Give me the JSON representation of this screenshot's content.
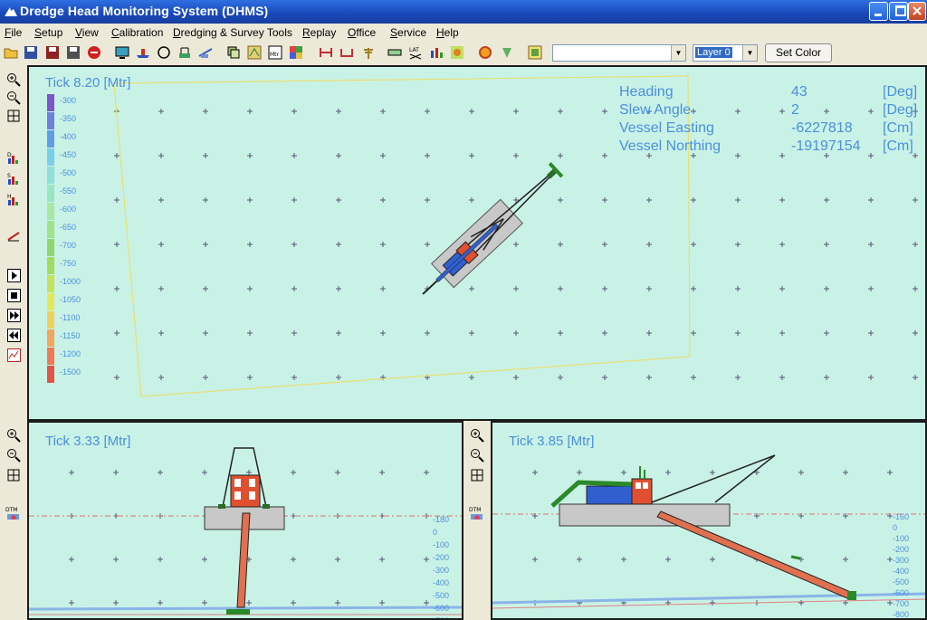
{
  "window": {
    "title": "Dredge Head Monitoring System (DHMS)"
  },
  "menu": [
    "File",
    "Setup",
    "View",
    "Calibration",
    "Dredging & Survey Tools",
    "Replay",
    "Office",
    "Service",
    "Help"
  ],
  "toolbar": {
    "combo_value": "",
    "layer_value": "Layer 0",
    "set_color_label": "Set Color"
  },
  "plan_view": {
    "tick_label": "Tick 8.20 [Mtr]",
    "info": [
      {
        "label": "Heading",
        "value": "43",
        "unit": "[Deg]"
      },
      {
        "label": "Slew Angle",
        "value": "2",
        "unit": "[Deg]"
      },
      {
        "label": "Vessel Easting",
        "value": "-6227818",
        "unit": "[Cm]"
      },
      {
        "label": "Vessel Northing",
        "value": "-19197154",
        "unit": "[Cm]"
      }
    ],
    "legend": [
      {
        "label": "-300",
        "color": "#7a55cc"
      },
      {
        "label": "-350",
        "color": "#6f7fdc"
      },
      {
        "label": "-400",
        "color": "#5f9ee6"
      },
      {
        "label": "-450",
        "color": "#78cfe8"
      },
      {
        "label": "-500",
        "color": "#8ee0d8"
      },
      {
        "label": "-550",
        "color": "#98e6c2"
      },
      {
        "label": "-600",
        "color": "#a6e8a4"
      },
      {
        "label": "-650",
        "color": "#9fe48c"
      },
      {
        "label": "-700",
        "color": "#8ed86e"
      },
      {
        "label": "-750",
        "color": "#a2dc5c"
      },
      {
        "label": "-1000",
        "color": "#c4e25a"
      },
      {
        "label": "-1050",
        "color": "#e2e858"
      },
      {
        "label": "-1100",
        "color": "#f0d05a"
      },
      {
        "label": "-1150",
        "color": "#f2a65a"
      },
      {
        "label": "-1200",
        "color": "#ee7a56"
      },
      {
        "label": "-1500",
        "color": "#e05548"
      }
    ]
  },
  "side_view": {
    "tick_label": "Tick 3.33 [Mtr]",
    "depth_labels": [
      "-180",
      "0",
      "-100",
      "-200",
      "-300",
      "-400",
      "-500",
      "-600",
      "-700"
    ]
  },
  "profile_view": {
    "tick_label": "Tick 3.85 [Mtr]",
    "depth_labels": [
      "-160",
      "0",
      "-100",
      "-200",
      "-300",
      "-400",
      "-500",
      "-600",
      "-700",
      "-800"
    ]
  }
}
